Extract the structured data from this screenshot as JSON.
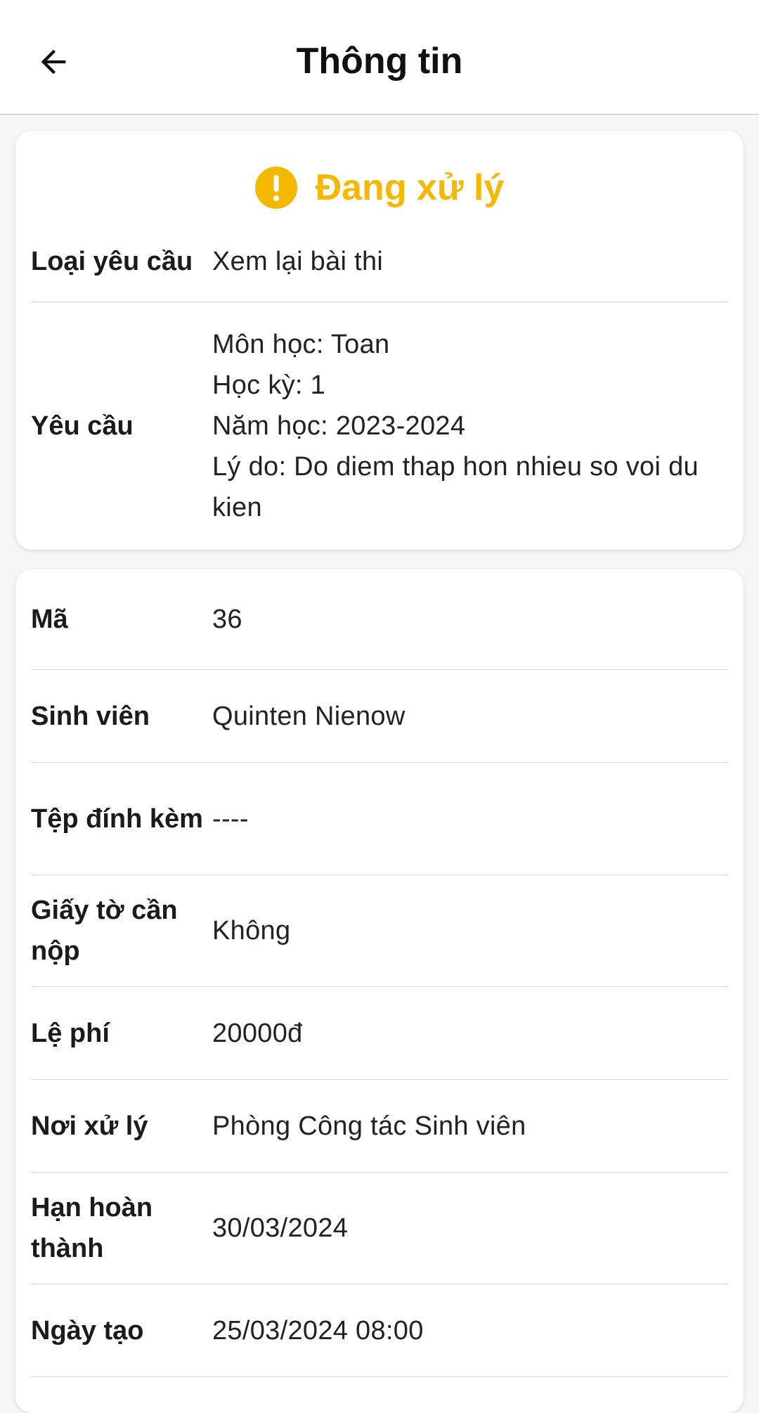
{
  "header": {
    "title": "Thông tin"
  },
  "status": {
    "label": "Đang xử lý",
    "color": "#f5b800",
    "icon": "exclamation-circle-icon"
  },
  "summary": {
    "request_type_label": "Loại yêu cầu",
    "request_type_value": "Xem lại bài thi",
    "request_label": "Yêu cầu",
    "request_lines": [
      "Môn học: Toan",
      "Học kỳ: 1",
      "Năm học: 2023-2024",
      "Lý do: Do diem thap hon nhieu so voi du kien"
    ]
  },
  "details": [
    {
      "label": "Mã",
      "value": "36"
    },
    {
      "label": "Sinh viên",
      "value": "Quinten Nienow"
    },
    {
      "label": "Tệp đính kèm",
      "value": "----"
    },
    {
      "label": "Giấy tờ cần nộp",
      "value": "Không"
    },
    {
      "label": "Lệ phí",
      "value": "20000đ"
    },
    {
      "label": "Nơi xử lý",
      "value": "Phòng Công tác Sinh viên"
    },
    {
      "label": "Hạn hoàn thành",
      "value": "30/03/2024"
    },
    {
      "label": "Ngày tạo",
      "value": "25/03/2024 08:00"
    }
  ]
}
